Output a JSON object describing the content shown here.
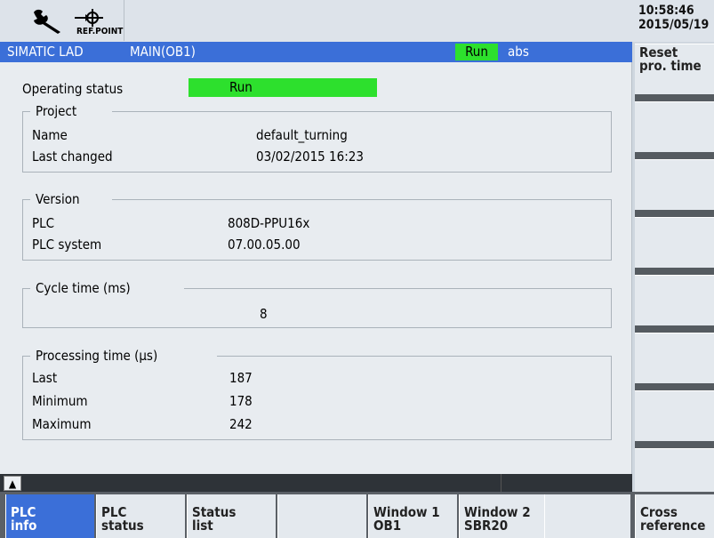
{
  "top": {
    "icon_wrench": "wrench-icon",
    "icon_refpoint": "reference-point-icon",
    "refpoint_label": "REF.POINT",
    "clock_time": "10:58:46",
    "clock_date": "2015/05/19"
  },
  "titlebar": {
    "app": "SIMATIC LAD",
    "program": "MAIN(OB1)",
    "state": "Run",
    "mode": "abs"
  },
  "main": {
    "operating_status_label": "Operating status",
    "operating_status_value": "Run",
    "project": {
      "title": "Project",
      "name_label": "Name",
      "name_value": "default_turning",
      "changed_label": "Last changed",
      "changed_value": "03/02/2015 16:23"
    },
    "version": {
      "title": "Version",
      "plc_label": "PLC",
      "plc_value": "808D-PPU16x",
      "sys_label": "PLC system",
      "sys_value": "07.00.05.00"
    },
    "cycle": {
      "title": "Cycle time (ms)",
      "value": "8"
    },
    "processing": {
      "title": "Processing time (µs)",
      "last_label": "Last",
      "last_value": "187",
      "min_label": "Minimum",
      "min_value": "178",
      "max_label": "Maximum",
      "max_value": "242"
    }
  },
  "vertical_softkeys": [
    {
      "l1": "Reset",
      "l2": "pro. time"
    },
    {
      "l1": "",
      "l2": ""
    },
    {
      "l1": "",
      "l2": ""
    },
    {
      "l1": "",
      "l2": ""
    },
    {
      "l1": "",
      "l2": ""
    },
    {
      "l1": "",
      "l2": ""
    },
    {
      "l1": "",
      "l2": ""
    },
    {
      "l1": "",
      "l2": ""
    }
  ],
  "horizontal_softkeys": [
    {
      "l1": "PLC",
      "l2": "info",
      "active": true
    },
    {
      "l1": "PLC",
      "l2": "status"
    },
    {
      "l1": "Status",
      "l2": "list"
    },
    {
      "l1": "",
      "l2": ""
    },
    {
      "l1": "Window 1",
      "l2": "OB1"
    },
    {
      "l1": "Window 2",
      "l2": "SBR20"
    },
    {
      "l1": "",
      "l2": ""
    },
    {
      "l1": "Cross",
      "l2": "reference"
    }
  ],
  "colors": {
    "title_blue": "#3b6fd8",
    "run_green": "#2de02d"
  },
  "scroll_up_icon": "up-arrow-icon",
  "scroll_up_glyph": "▲"
}
